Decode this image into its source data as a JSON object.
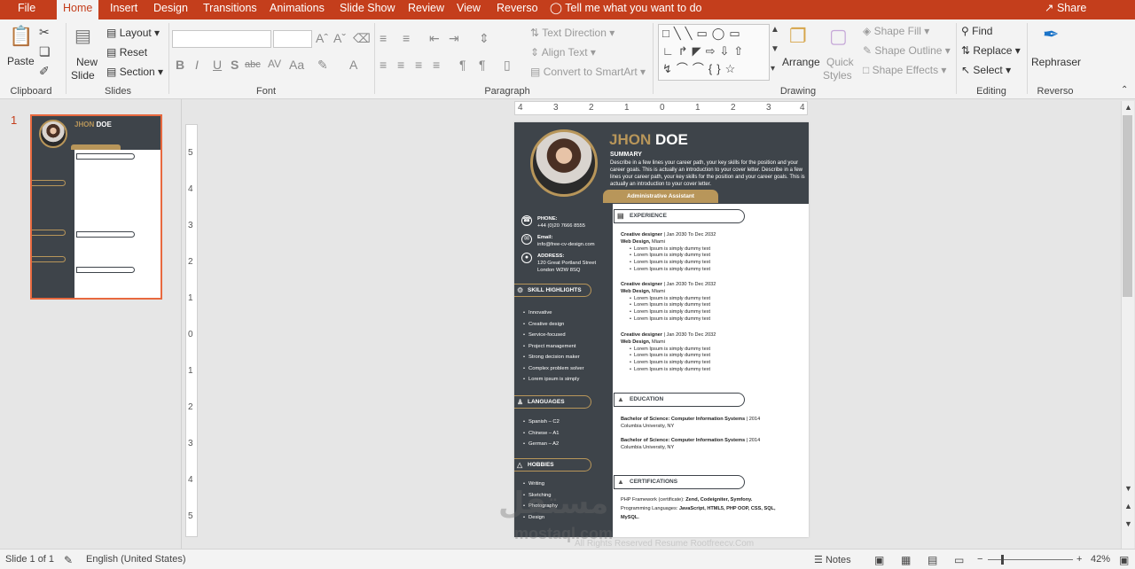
{
  "tabs": [
    "File",
    "Home",
    "Insert",
    "Design",
    "Transitions",
    "Animations",
    "Slide Show",
    "Review",
    "View",
    "Reverso"
  ],
  "active_tab": "Home",
  "tell_me": "Tell me what you want to do",
  "share": "Share",
  "ribbon": {
    "groups": [
      "Clipboard",
      "Slides",
      "Font",
      "Paragraph",
      "Drawing",
      "Editing",
      "Reverso"
    ],
    "clipboard": {
      "paste": "Paste"
    },
    "slides": {
      "new_slide_line1": "New",
      "new_slide_line2": "Slide",
      "layout": "Layout",
      "reset": "Reset",
      "section": "Section"
    },
    "paragraph": {
      "text_direction": "Text Direction",
      "align_text": "Align Text",
      "convert_smartart": "Convert to SmartArt"
    },
    "drawing": {
      "arrange": "Arrange",
      "quick_styles_1": "Quick",
      "quick_styles_2": "Styles",
      "shape_fill": "Shape Fill",
      "shape_outline": "Shape Outline",
      "shape_effects": "Shape Effects"
    },
    "editing": {
      "find": "Find",
      "replace": "Replace",
      "select": "Select"
    },
    "reverso": {
      "rephraser": "Rephraser"
    }
  },
  "thumbnail_number": "1",
  "ruler_h": [
    "4",
    "3",
    "2",
    "1",
    "0",
    "1",
    "2",
    "3",
    "4"
  ],
  "ruler_v": [
    "5",
    "4",
    "3",
    "2",
    "1",
    "0",
    "1",
    "2",
    "3",
    "4",
    "5"
  ],
  "resume": {
    "first_name": "JHON",
    "last_name": "DOE",
    "summary_title": "SUMMARY",
    "summary_text": "Describe in a few lines your career path, your key skills for the position and your career goals. This is actually an introduction to your cover letter. Describe in a few lines your career path, your key skills for the position and your career goals. This is actually an introduction to your cover letter.",
    "role": "Administrative Assistant",
    "phone_label": "PHONE:",
    "phone": "+44 (0)20 7666 8555",
    "email_label": "Email:",
    "email": "info@free-cv-design.com",
    "address_label": "ADDRESS:",
    "address_1": "120 Great Portland Street",
    "address_2": "London W2W 8SQ",
    "skills_title": "SKILL HIGHLIGHTS",
    "skills": [
      "Innovative",
      "Creative design",
      "Service-focused",
      "Project management",
      "Strong decision maker",
      "Complex problem solver",
      "Lorem ipsum is simply"
    ],
    "languages_title": "LANGUAGES",
    "languages": [
      "Spanish – C2",
      "Chinese – A1",
      "German – A2"
    ],
    "hobbies_title": "HOBBIES",
    "hobbies": [
      "Writing",
      "Sketching",
      "Photography",
      "Design"
    ],
    "experience_title": "EXPERIENCE",
    "jobs": [
      {
        "title": "Creative designer",
        "dates": "| Jan 2030 To Dec 2032",
        "company": "Web Design,",
        "city": "Miami",
        "bullets": [
          "Lorem Ipsum is simply dummy text",
          "Lorem Ipsum is simply dummy text",
          "Lorem Ipsum is simply dummy text",
          "Lorem Ipsum is simply dummy text"
        ]
      },
      {
        "title": "Creative designer",
        "dates": "| Jan 2030 To Dec 2032",
        "company": "Web Design,",
        "city": "Miami",
        "bullets": [
          "Lorem Ipsum is simply dummy text",
          "Lorem Ipsum is simply dummy text",
          "Lorem Ipsum is simply dummy text",
          "Lorem Ipsum is simply dummy text"
        ]
      },
      {
        "title": "Creative designer",
        "dates": "| Jan 2030 To Dec 2032",
        "company": "Web Design,",
        "city": "Miami",
        "bullets": [
          "Lorem Ipsum is simply dummy text",
          "Lorem Ipsum is simply dummy text",
          "Lorem Ipsum is simply dummy text",
          "Lorem Ipsum is simply dummy text"
        ]
      }
    ],
    "education_title": "EDUCATION",
    "education": [
      {
        "degree": "Bachelor of Science: Computer Information Systems",
        "year": "| 2014",
        "school": "Columbia University, NY"
      },
      {
        "degree": "Bachelor of Science: Computer Information Systems",
        "year": "| 2014",
        "school": "Columbia University, NY"
      }
    ],
    "certifications_title": "CERTIFICATIONS",
    "cert_1_label": "PHP Framework (certificate):",
    "cert_1_value": "Zend, Codeigniter, Symfony.",
    "cert_2_label": "Programming Languages:",
    "cert_2_value": "JavaScript, HTML5, PHP OOP, CSS, SQL, MySQL."
  },
  "footer_ghost": "All Rights Reserved Resume Rootfreecv.Com",
  "status": {
    "slide": "Slide 1 of 1",
    "language": "English (United States)",
    "notes": "Notes",
    "zoom": "42%"
  },
  "watermark": {
    "arabic": "مستقل",
    "latin": "mostaql.com"
  },
  "colors": {
    "accent": "#c43e1c",
    "gold": "#b8965a",
    "dark": "#3e444a"
  }
}
